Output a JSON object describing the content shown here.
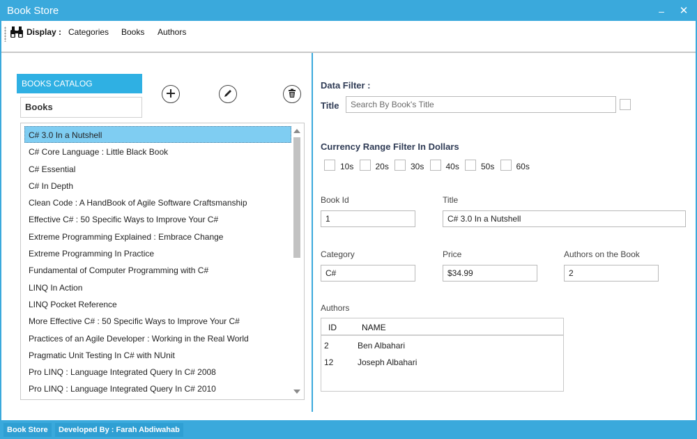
{
  "window": {
    "title": "Book Store",
    "minimize_glyph": "–",
    "close_glyph": "✕"
  },
  "toolbar": {
    "icon": "binoculars-icon",
    "display_label": "Display :",
    "links": [
      "Categories",
      "Books",
      "Authors"
    ]
  },
  "left": {
    "catalog_header": "BOOKS CATALOG",
    "books_label": "Books",
    "actions": [
      "add-icon",
      "edit-icon",
      "delete-icon"
    ],
    "selected_index": 0,
    "books": [
      "C# 3.0 In a Nutshell",
      "C# Core Language : Little Black Book",
      "C# Essential",
      "C# In Depth",
      "Clean Code : A HandBook of Agile Software Craftsmanship",
      "Effective C# : 50 Specific Ways to Improve Your C#",
      "Extreme Programming Explained : Embrace Change",
      "Extreme Programming In Practice",
      "Fundamental of Computer Programming with C#",
      "LINQ In Action",
      "LINQ Pocket Reference",
      "More Effective C# : 50 Specific Ways to Improve Your C#",
      "Practices of an Agile Developer : Working in the Real World",
      "Pragmatic Unit Testing In C# with NUnit",
      "Pro LINQ : Language Integrated Query In C# 2008",
      "Pro LINQ : Language Integrated Query In C# 2010"
    ]
  },
  "filter": {
    "title": "Data Filter :",
    "title_label": "Title",
    "search_placeholder": "Search By Book's Title",
    "currency_title": "Currency Range Filter In Dollars",
    "ranges": [
      "10s",
      "20s",
      "30s",
      "40s",
      "50s",
      "60s"
    ]
  },
  "details": {
    "book_id_label": "Book Id",
    "book_id": "1",
    "title_label": "Title",
    "title": "C# 3.0 In a Nutshell",
    "category_label": "Category",
    "category": "C#",
    "price_label": "Price",
    "price": "$34.99",
    "authors_count_label": "Authors on the Book",
    "authors_count": "2",
    "authors_label": "Authors",
    "authors_columns": [
      "ID",
      "NAME"
    ],
    "authors": [
      {
        "id": "2",
        "name": "Ben Albahari"
      },
      {
        "id": "12",
        "name": "Joseph Albahari"
      }
    ]
  },
  "status": {
    "app": "Book Store",
    "developer": "Developed By : Farah Abdiwahab"
  },
  "colors": {
    "accent": "#3aa9dc",
    "selection": "#7fcdf2",
    "catalog_header": "#2fb0e3"
  }
}
